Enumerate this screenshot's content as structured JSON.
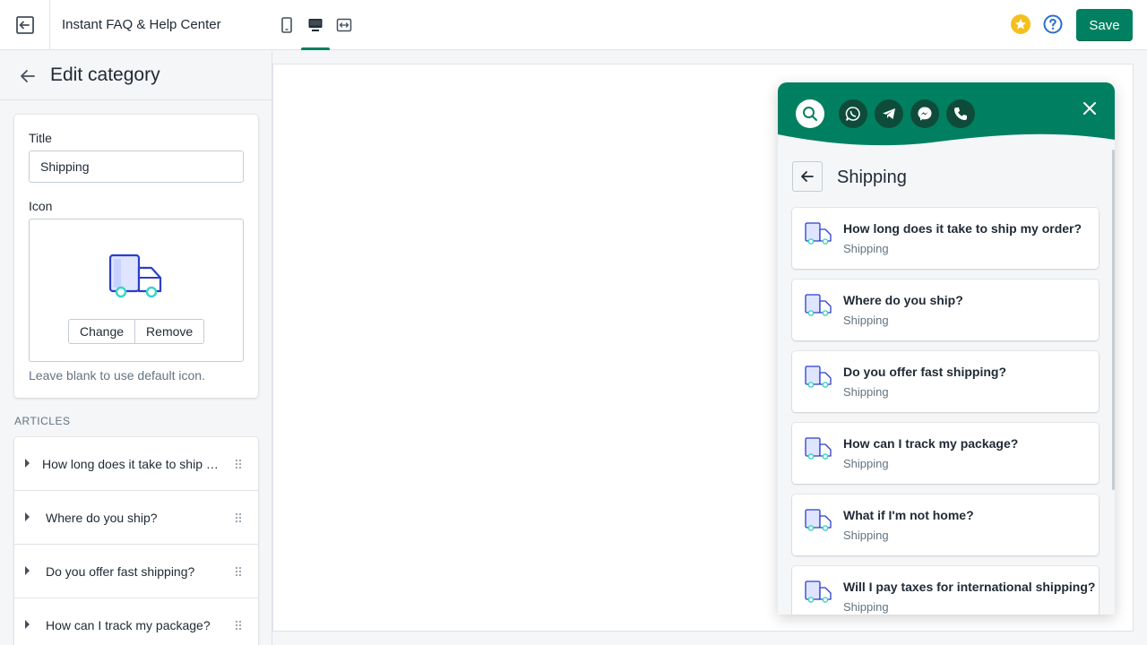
{
  "topbar": {
    "app_title": "Instant FAQ & Help Center",
    "save_label": "Save",
    "icons": [
      "exit-icon",
      "mobile-view-icon",
      "desktop-view-icon",
      "fullwidth-view-icon",
      "star-icon",
      "help-icon"
    ]
  },
  "sidebar": {
    "title": "Edit category",
    "form": {
      "title_label": "Title",
      "title_value": "Shipping",
      "icon_label": "Icon",
      "change_label": "Change",
      "remove_label": "Remove",
      "hint": "Leave blank to use default icon."
    },
    "articles_heading": "ARTICLES",
    "articles": [
      {
        "label": "How long does it take to ship my order?"
      },
      {
        "label": "Where do you ship?"
      },
      {
        "label": "Do you offer fast shipping?"
      },
      {
        "label": "How can I track my package?"
      }
    ]
  },
  "widget": {
    "title": "Shipping",
    "header_icons": [
      "search-icon",
      "whatsapp-icon",
      "telegram-icon",
      "messenger-icon",
      "phone-icon",
      "close-icon"
    ],
    "faqs": [
      {
        "question": "How long does it take to ship my order?",
        "category": "Shipping"
      },
      {
        "question": "Where do you ship?",
        "category": "Shipping"
      },
      {
        "question": "Do you offer fast shipping?",
        "category": "Shipping"
      },
      {
        "question": "How can I track my package?",
        "category": "Shipping"
      },
      {
        "question": "What if I'm not home?",
        "category": "Shipping"
      },
      {
        "question": "Will I pay taxes for international shipping?",
        "category": "Shipping"
      }
    ]
  },
  "colors": {
    "primary": "#008060",
    "widget_header": "#008060",
    "widget_icon_dark": "#0f4b3a",
    "truck_stroke": "#2c3ec9",
    "truck_wheel": "#37d6c4",
    "star": "#f4c01e",
    "help": "#2c6ecb"
  }
}
